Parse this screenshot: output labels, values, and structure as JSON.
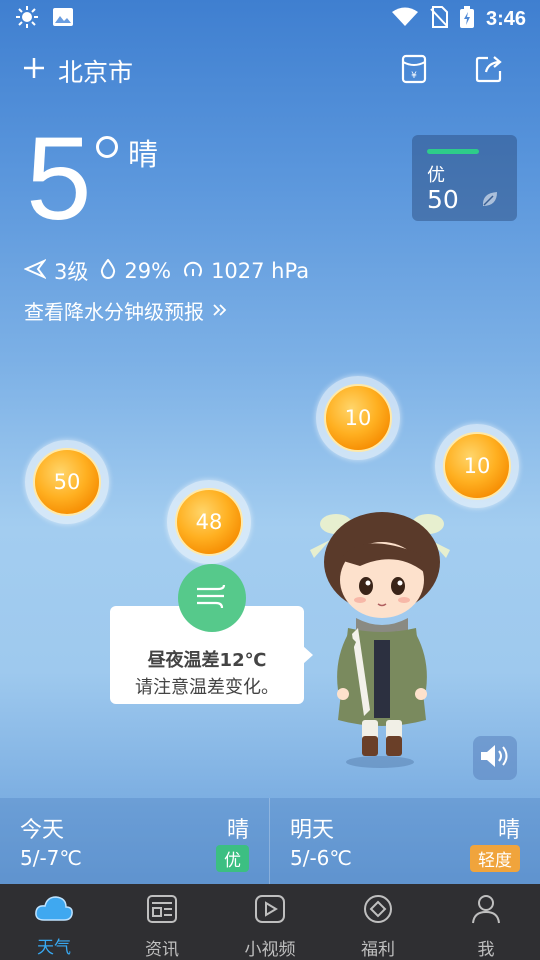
{
  "status_bar": {
    "time": "3:46"
  },
  "header": {
    "city": "北京市"
  },
  "current": {
    "temperature": "5",
    "condition": "晴",
    "wind": "3级",
    "humidity": "29%",
    "pressure": "1027 hPa",
    "forecast_link": "查看降水分钟级预报"
  },
  "aqi": {
    "label": "优",
    "value": "50",
    "bar_color": "#2ecc8a"
  },
  "coins": [
    "50",
    "48",
    "10",
    "10"
  ],
  "tip": {
    "title": "昼夜温差12℃",
    "subtitle": "请注意温差变化。"
  },
  "today": {
    "name": "今天",
    "condition": "晴",
    "temp": "5/-7℃",
    "aqi": "优",
    "aqi_color": "#3cbf82"
  },
  "tomorrow": {
    "name": "明天",
    "condition": "晴",
    "temp": "5/-6℃",
    "aqi": "轻度",
    "aqi_color": "#f0a43c"
  },
  "nav": [
    {
      "label": "天气",
      "icon": "cloud-icon",
      "active": true
    },
    {
      "label": "资讯",
      "icon": "news-icon"
    },
    {
      "label": "小视频",
      "icon": "play-icon"
    },
    {
      "label": "福利",
      "icon": "diamond-icon"
    },
    {
      "label": "我",
      "icon": "person-icon"
    }
  ],
  "accent": "#38a9f2"
}
